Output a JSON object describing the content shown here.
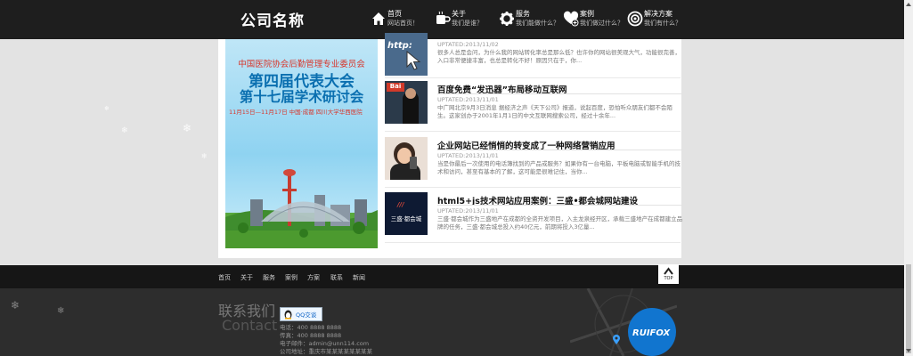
{
  "header": {
    "logo": "公司名称",
    "nav": [
      {
        "label": "首页",
        "sub": "网站首页！",
        "icon": "home-icon"
      },
      {
        "label": "关于",
        "sub": "我们是谁？",
        "icon": "coffee-cup-icon"
      },
      {
        "label": "服务",
        "sub": "我们能做什么？",
        "icon": "gear-icon"
      },
      {
        "label": "案例",
        "sub": "我们做过什么？",
        "icon": "heart-plus-icon"
      },
      {
        "label": "解决方案",
        "sub": "我们有什么？",
        "icon": "target-icon"
      }
    ]
  },
  "poster": {
    "line1": "中国医院协会后勤管理专业委员会",
    "line2": "第四届代表大会",
    "line3": "第十七届学术研讨会",
    "line4": "11月15日—11月17日 中国·成都  四川大学华西医院"
  },
  "posts": [
    {
      "title": "",
      "date": "UPTATED:2013/11/02",
      "excerpt": "很多人总是会问，为什么我的网站转化率总是那么低？也许你的网站很美观大气，功能很完善，入口非常便捷丰富，也总是转化不好！原因只在于，你...",
      "thumb_text": "http:"
    },
    {
      "title": "百度免费“发迅器”布局移动互联网",
      "date": "UPTATED:2013/11/01",
      "excerpt": "中广网北京9月3日消息 据经济之声《天下公司》报道，说起百度，恐怕听众朋友们都不会陌生。这家创办于2001年1月1日的中文互联网搜索公司，经过十余年...",
      "thumb_text": "Bai"
    },
    {
      "title": "企业网站已经悄悄的转变成了一种网络营销应用",
      "date": "UPTATED:2013/11/01",
      "excerpt": "当是你最后一次使用的电话簿找到的产品或服务？如果你有一台电脑，平板电脑或智能手机的技术和访问，甚至有基本的了解，这可能是很难记住，当你...",
      "thumb_text": ""
    },
    {
      "title": "html5+js技术网站应用案例：三盛•都会城网站建设",
      "date": "UPTATED:2013/11/01",
      "excerpt": "三盛·都会城作为三盛地产在成都的全资开发项目，入主龙泉经开区，承载三盛地产在成都建立品牌的任务，三盛·都会城总投入约40亿元，前期将投入3亿量...",
      "thumb_text": "三盛·都会城"
    }
  ],
  "footer_nav": [
    "首页",
    "关于",
    "服务",
    "案例",
    "方案",
    "联系",
    "新闻"
  ],
  "to_top_label": "TOP",
  "contact": {
    "title": "联系我们",
    "subtitle": "Contact",
    "qq_label": "QQ交谈",
    "phone": "电话：400 8888 8888",
    "fax": "传真：400 8888 8888",
    "email": "电子邮件：admin@unn114.com",
    "address": "公司地址：重庆市某某某某某某某某"
  },
  "brand_logo": "RUIFOX",
  "colors": {
    "header_bg": "#1e1e1e",
    "brand_blue": "#1175cf",
    "page_bg": "#e3e3e3"
  }
}
